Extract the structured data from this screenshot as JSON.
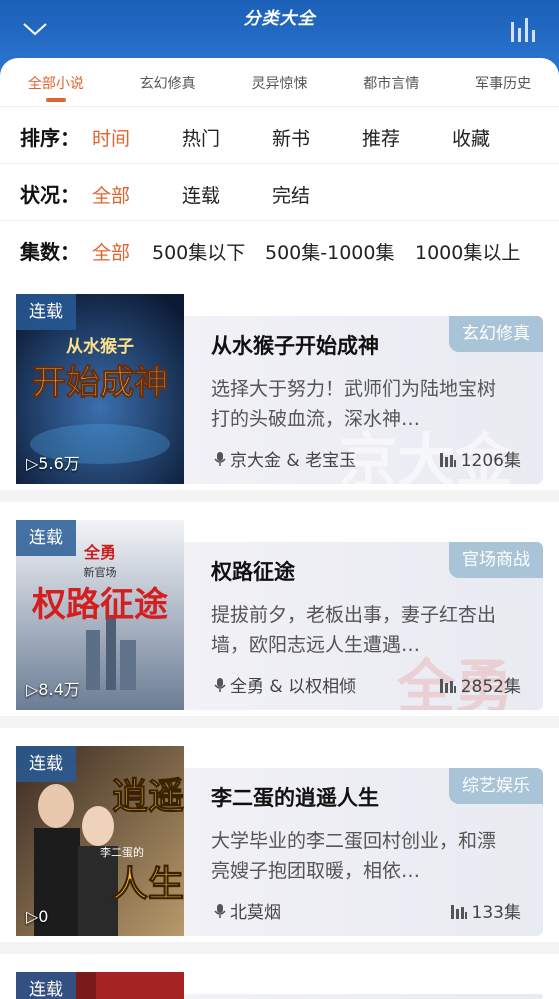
{
  "header": {
    "title": "分类大全"
  },
  "tabs": [
    {
      "label": "全部小说",
      "active": true
    },
    {
      "label": "玄幻修真"
    },
    {
      "label": "灵异惊悚"
    },
    {
      "label": "都市言情"
    },
    {
      "label": "军事历史"
    }
  ],
  "filters": {
    "sort": {
      "label": "排序：",
      "options": [
        "时间",
        "热门",
        "新书",
        "推荐",
        "收藏"
      ],
      "selected": "时间"
    },
    "status": {
      "label": "状况：",
      "options": [
        "全部",
        "连载",
        "完结"
      ],
      "selected": "全部"
    },
    "episodes": {
      "label": "集数：",
      "options": [
        "全部",
        "500集以下",
        "500集-1000集",
        "1000集以上"
      ],
      "selected": "全部"
    }
  },
  "books": [
    {
      "status": "连载",
      "plays": "▷5.6万",
      "genre": "玄幻修真",
      "title": "从水猴子开始成神",
      "desc": "选择大于努力！武师们为陆地宝树打的头破血流，深水神…",
      "authors": "京大金 & 老宝玉",
      "episodes": "1206集",
      "cover_text": [
        "从水猴子",
        "开始成神"
      ]
    },
    {
      "status": "连载",
      "plays": "▷8.4万",
      "genre": "官场商战",
      "title": "权路征途",
      "desc": "提拔前夕，老板出事，妻子红杏出墙，欧阳志远人生遭遇…",
      "authors": "全勇 & 以权相倾",
      "episodes": "2852集",
      "cover_text": [
        "全勇",
        "新官场",
        "权路征途"
      ]
    },
    {
      "status": "连载",
      "plays": "▷0",
      "genre": "综艺娱乐",
      "title": "李二蛋的逍遥人生",
      "desc": "大学毕业的李二蛋回村创业，和漂亮嫂子抱团取暖，相依…",
      "authors": "北莫烟",
      "episodes": "133集",
      "cover_text": [
        "逍遥",
        "人生",
        "李二蛋的"
      ]
    },
    {
      "status": "连载"
    }
  ],
  "colors": {
    "accent": "#e0642e",
    "header": "#2f7ad4"
  }
}
